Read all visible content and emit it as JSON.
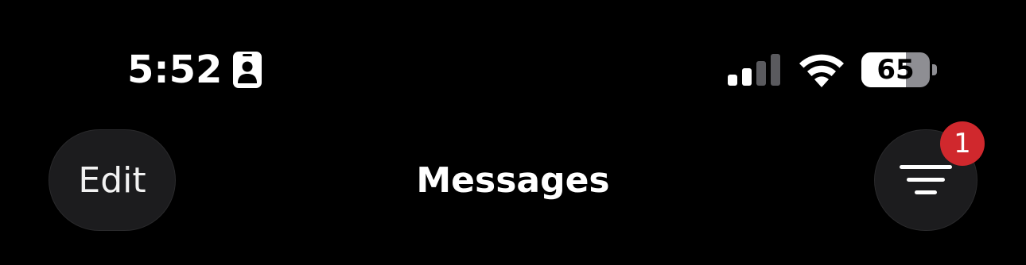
{
  "status_bar": {
    "time": "5:52",
    "focus_icon": "person-id-card-icon",
    "signal_icon": "cellular-signal-icon",
    "signal_bars_active": 2,
    "signal_bars_total": 4,
    "wifi_icon": "wifi-icon",
    "battery_icon": "battery-icon",
    "battery_level": 65,
    "battery_text": "65"
  },
  "nav_bar": {
    "edit_label": "Edit",
    "title": "Messages",
    "filter_icon": "filter-lines-icon",
    "filter_badge_count": "1"
  },
  "colors": {
    "background": "#000000",
    "button_background": "#1c1c1e",
    "badge": "#d0282d",
    "text": "#ffffff",
    "battery_empty": "#8e8e93"
  }
}
